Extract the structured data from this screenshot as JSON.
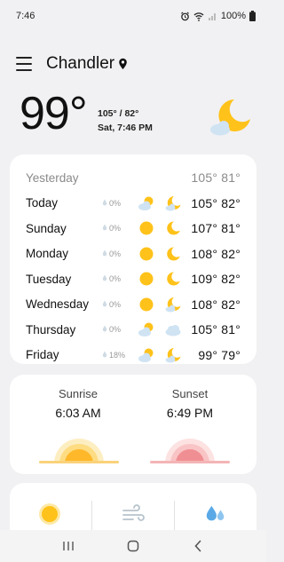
{
  "status_bar": {
    "time": "7:46",
    "battery": "100%"
  },
  "header": {
    "city": "Chandler"
  },
  "current": {
    "temp": "99°",
    "hi_lo": "105° / 82°",
    "date_time": "Sat, 7:46 PM",
    "icon": "moon-cloud-icon"
  },
  "forecast": {
    "yesterday": {
      "label": "Yesterday",
      "temps": "105° 81°"
    },
    "days": [
      {
        "day": "Today",
        "precip": "0%",
        "day_icon": "partly-sunny-icon",
        "night_icon": "moon-cloud-icon",
        "temps": "105° 82°"
      },
      {
        "day": "Sunday",
        "precip": "0%",
        "day_icon": "sun-icon",
        "night_icon": "moon-icon",
        "temps": "107° 81°"
      },
      {
        "day": "Monday",
        "precip": "0%",
        "day_icon": "sun-icon",
        "night_icon": "moon-icon",
        "temps": "108° 82°"
      },
      {
        "day": "Tuesday",
        "precip": "0%",
        "day_icon": "sun-icon",
        "night_icon": "moon-icon",
        "temps": "109° 82°"
      },
      {
        "day": "Wednesday",
        "precip": "0%",
        "day_icon": "sun-icon",
        "night_icon": "moon-cloud-icon",
        "temps": "108° 82°"
      },
      {
        "day": "Thursday",
        "precip": "0%",
        "day_icon": "partly-sunny-icon",
        "night_icon": "cloud-icon",
        "temps": "105° 81°"
      },
      {
        "day": "Friday",
        "precip": "18%",
        "day_icon": "partly-sunny-icon",
        "night_icon": "moon-cloud-icon",
        "temps": "99° 79°"
      }
    ]
  },
  "sun": {
    "sunrise_label": "Sunrise",
    "sunrise_time": "6:03 AM",
    "sunset_label": "Sunset",
    "sunset_time": "6:49 PM"
  },
  "bottom": {
    "icons": [
      "uv-sun-icon",
      "wind-icon",
      "humidity-drops-icon"
    ]
  },
  "colors": {
    "sun": "#ffc21a",
    "moon": "#ffc21a",
    "cloud": "#cfe3f3",
    "sunset": "#f08f93",
    "background": "#f1f1f3"
  }
}
